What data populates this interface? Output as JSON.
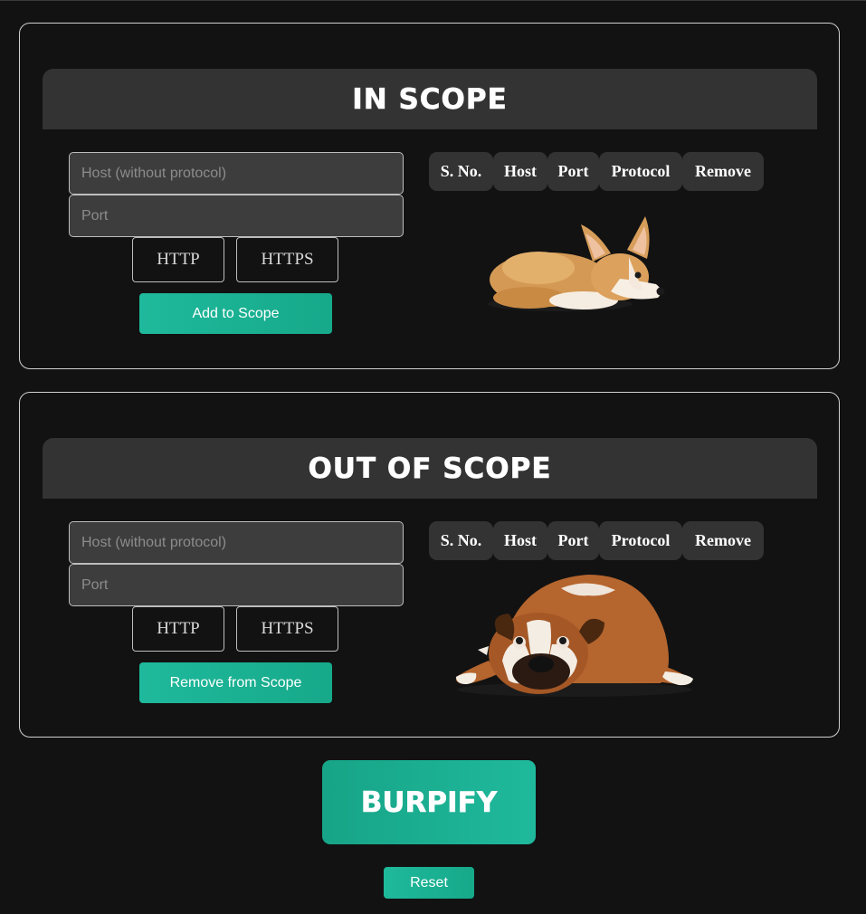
{
  "in_scope": {
    "title": "IN SCOPE",
    "host_placeholder": "Host (without protocol)",
    "port_placeholder": "Port",
    "http_label": "HTTP",
    "https_label": "HTTPS",
    "action_label": "Add to Scope",
    "columns": [
      "S. No.",
      "Host",
      "Port",
      "Protocol",
      "Remove"
    ],
    "image": "corgi-dog"
  },
  "out_scope": {
    "title": "OUT OF SCOPE",
    "host_placeholder": "Host (without protocol)",
    "port_placeholder": "Port",
    "http_label": "HTTP",
    "https_label": "HTTPS",
    "action_label": "Remove from Scope",
    "columns": [
      "S. No.",
      "Host",
      "Port",
      "Protocol",
      "Remove"
    ],
    "image": "bulldog"
  },
  "burpify_label": "BURPIFY",
  "reset_label": "Reset",
  "colors": {
    "background": "#121212",
    "panel_header": "#333333",
    "accent": "#1fb99c",
    "field_bg": "#3d3d3d"
  }
}
